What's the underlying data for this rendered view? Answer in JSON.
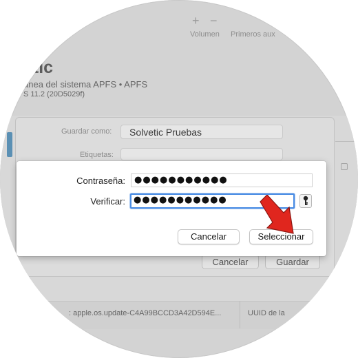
{
  "toolbar": {
    "plus_icon": "plus-icon",
    "minus_icon": "minus-icon",
    "volume_label": "Volumen",
    "first_aid_label": "Primeros aux"
  },
  "volume": {
    "title": "etic",
    "subtitle": "ánea del sistema APFS • APFS",
    "version": "S 11.2 (20D5029f)"
  },
  "save_sheet": {
    "save_as_label": "Guardar como:",
    "save_as_value": "Solvetic Pruebas",
    "tags_label": "Etiquetas:",
    "tags_value": "",
    "cancel_label": "Cancelar",
    "save_label": "Guardar"
  },
  "password_dialog": {
    "password_label": "Contraseña:",
    "password_value": "●●●●●●●●●●●",
    "verify_label": "Verificar:",
    "verify_value": "●●●●●●●●●●●",
    "key_icon": "key-icon",
    "cancel_label": "Cancelar",
    "select_label": "Seleccionar"
  },
  "info_table": {
    "cell_1": ": apple.os.update-C4A99BCCD3A42D594E...",
    "cell_2": "UUID de la"
  },
  "colors": {
    "focus_ring": "#4b8de4",
    "arrow": "#e0261e",
    "accent_bar": "#5b90b4"
  }
}
